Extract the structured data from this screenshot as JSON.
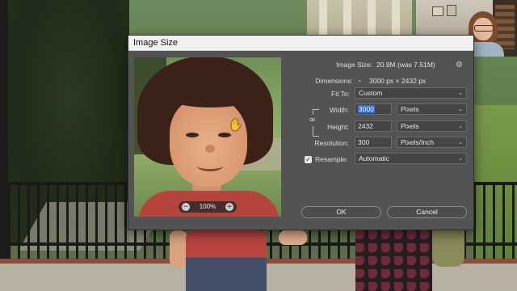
{
  "dialog": {
    "title": "Image Size",
    "image_size_label": "Image Size:",
    "image_size_value": "20.9M (was 7.51M)",
    "dimensions_label": "Dimensions:",
    "dimensions_value": "3000 px  ×  2432 px",
    "fit_to_label": "Fit To:",
    "fit_to_value": "Custom",
    "width_label": "Width:",
    "width_value": "3000",
    "width_unit": "Pixels",
    "height_label": "Height:",
    "height_value": "2432",
    "height_unit": "Pixels",
    "resolution_label": "Resolution:",
    "resolution_value": "300",
    "resolution_unit": "Pixels/Inch",
    "resample_label": "Resample:",
    "resample_checked": true,
    "resample_value": "Automatic",
    "ok_label": "OK",
    "cancel_label": "Cancel",
    "preview_zoom": "100%",
    "zoom_out_glyph": "−",
    "zoom_in_glyph": "+"
  },
  "icons": {
    "gear": "⚙",
    "chevron": "⌄",
    "caret": "⌄",
    "link": "∞",
    "check": "✓",
    "cursor": "✋"
  }
}
